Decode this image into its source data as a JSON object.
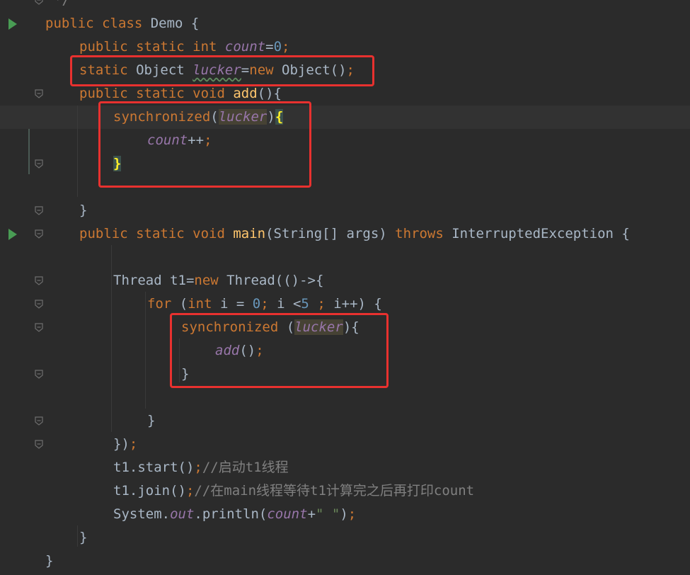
{
  "code_lines": [
    {
      "spans": [
        {
          "c": "cmt",
          "t": "*/"
        }
      ]
    },
    {
      "spans": [
        {
          "c": "kw",
          "t": "public class "
        },
        {
          "c": "txt",
          "t": "Demo {"
        }
      ]
    },
    {
      "spans": [
        {
          "c": "kw",
          "t": "public static int "
        },
        {
          "c": "field",
          "t": "count"
        },
        {
          "c": "txt",
          "t": "="
        },
        {
          "c": "num",
          "t": "0"
        },
        {
          "c": "kw",
          "t": ";"
        }
      ]
    },
    {
      "spans": [
        {
          "c": "kw",
          "t": "static "
        },
        {
          "c": "txt",
          "t": "Object "
        },
        {
          "c": "field wavy",
          "t": "lucker"
        },
        {
          "c": "txt",
          "t": "="
        },
        {
          "c": "kw",
          "t": "new "
        },
        {
          "c": "txt",
          "t": "Object()"
        },
        {
          "c": "kw",
          "t": ";"
        }
      ]
    },
    {
      "spans": [
        {
          "c": "kw",
          "t": "public static void "
        },
        {
          "c": "meth",
          "t": "add"
        },
        {
          "c": "txt",
          "t": "(){"
        }
      ]
    },
    {
      "spans": [
        {
          "c": "kw",
          "t": "synchronized"
        },
        {
          "c": "txt",
          "t": "("
        },
        {
          "c": "lk",
          "t": "lucker"
        },
        {
          "c": "txt",
          "t": ")"
        },
        {
          "c": "brace-hl",
          "t": "{"
        }
      ]
    },
    {
      "spans": [
        {
          "c": "field",
          "t": "count"
        },
        {
          "c": "txt",
          "t": "++"
        },
        {
          "c": "kw",
          "t": ";"
        }
      ]
    },
    {
      "spans": [
        {
          "c": "brace-hl",
          "t": "}"
        }
      ]
    },
    {
      "spans": []
    },
    {
      "spans": [
        {
          "c": "txt",
          "t": "}"
        }
      ]
    },
    {
      "spans": [
        {
          "c": "kw",
          "t": "public static void "
        },
        {
          "c": "meth",
          "t": "main"
        },
        {
          "c": "txt",
          "t": "(String[] args) "
        },
        {
          "c": "kw",
          "t": "throws "
        },
        {
          "c": "txt",
          "t": "InterruptedException {"
        }
      ]
    },
    {
      "spans": []
    },
    {
      "spans": [
        {
          "c": "txt",
          "t": "Thread t1="
        },
        {
          "c": "kw",
          "t": "new "
        },
        {
          "c": "txt",
          "t": "Thread(()->{"
        }
      ]
    },
    {
      "spans": [
        {
          "c": "kw",
          "t": "for "
        },
        {
          "c": "txt",
          "t": "("
        },
        {
          "c": "kw",
          "t": "int "
        },
        {
          "c": "txt",
          "t": "i = "
        },
        {
          "c": "num",
          "t": "0"
        },
        {
          "c": "kw",
          "t": "; "
        },
        {
          "c": "txt",
          "t": "i <"
        },
        {
          "c": "num",
          "t": "5 "
        },
        {
          "c": "kw",
          "t": "; "
        },
        {
          "c": "txt",
          "t": "i++) {"
        }
      ]
    },
    {
      "spans": [
        {
          "c": "kw",
          "t": "synchronized "
        },
        {
          "c": "txt",
          "t": "("
        },
        {
          "c": "lk",
          "t": "lucker"
        },
        {
          "c": "txt",
          "t": "){"
        }
      ]
    },
    {
      "spans": [
        {
          "c": "field",
          "t": "add"
        },
        {
          "c": "txt",
          "t": "()"
        },
        {
          "c": "kw",
          "t": ";"
        }
      ]
    },
    {
      "spans": [
        {
          "c": "txt",
          "t": "}"
        }
      ]
    },
    {
      "spans": []
    },
    {
      "spans": [
        {
          "c": "txt",
          "t": "}"
        }
      ]
    },
    {
      "spans": [
        {
          "c": "txt",
          "t": "})"
        },
        {
          "c": "kw",
          "t": ";"
        }
      ]
    },
    {
      "spans": [
        {
          "c": "txt",
          "t": "t1.start()"
        },
        {
          "c": "kw",
          "t": ";"
        },
        {
          "c": "cmt",
          "t": "//启动t1线程"
        }
      ]
    },
    {
      "spans": [
        {
          "c": "txt",
          "t": "t1.join()"
        },
        {
          "c": "kw",
          "t": ";"
        },
        {
          "c": "cmt",
          "t": "//在main线程等待t1计算完之后再打印count"
        }
      ]
    },
    {
      "spans": [
        {
          "c": "txt",
          "t": "System."
        },
        {
          "c": "field",
          "t": "out"
        },
        {
          "c": "txt",
          "t": ".println("
        },
        {
          "c": "field",
          "t": "count"
        },
        {
          "c": "txt",
          "t": "+"
        },
        {
          "c": "str",
          "t": "\" \""
        },
        {
          "c": "txt",
          "t": ")"
        },
        {
          "c": "kw",
          "t": ";"
        }
      ]
    },
    {
      "spans": [
        {
          "c": "txt",
          "t": "}"
        }
      ]
    },
    {
      "spans": [
        {
          "c": "txt",
          "t": "}"
        }
      ]
    }
  ],
  "colors": {
    "background": "#2b2b2b",
    "keyword": "#cc7832",
    "number": "#6897bb",
    "field": "#9876aa",
    "method": "#ffc66d",
    "comment": "#808080",
    "string": "#6a8759",
    "highlight_box": "#e8312f"
  },
  "gutter_icons": {
    "run": "run-gutter-icon",
    "fold": "fold-icon"
  }
}
